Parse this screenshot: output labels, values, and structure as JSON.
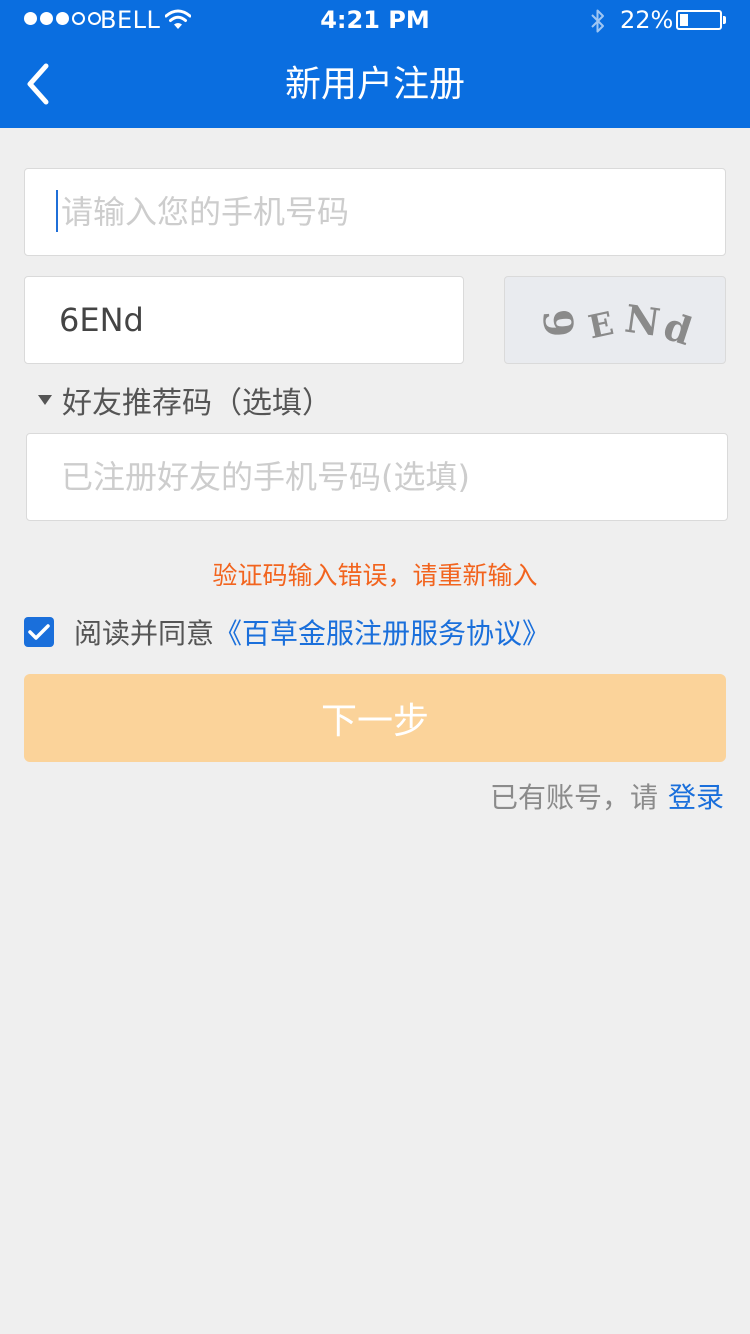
{
  "status_bar": {
    "carrier": "BELL",
    "time": "4:21 PM",
    "battery_percent": "22%",
    "battery_level": 0.22,
    "signal_bars_filled": 3,
    "signal_bars_total": 5,
    "icons": [
      "wifi-icon",
      "bluetooth-icon",
      "battery-icon"
    ]
  },
  "nav": {
    "title": "新用户注册",
    "back_icon": "chevron-left-icon"
  },
  "form": {
    "phone_placeholder": "请输入您的手机号码",
    "phone_value": "",
    "captcha_input_value": "6ENd",
    "captcha_image_text": "6ENd",
    "referral_toggle_label": "好友推荐码（选填）",
    "referral_placeholder": "已注册好友的手机号码(选填)",
    "referral_value": ""
  },
  "error_message": "验证码输入错误，请重新输入",
  "agreement": {
    "checked": true,
    "prefix": "阅读并同意",
    "link_text": "《百草金服注册服务协议》"
  },
  "next_button_label": "下一步",
  "login_prompt": {
    "text": "已有账号，请",
    "link": "登录"
  },
  "colors": {
    "primary": "#0a6ee0",
    "link": "#1a6fdb",
    "error": "#f2641e",
    "button_disabled": "#fbd39a",
    "background": "#efefef"
  }
}
